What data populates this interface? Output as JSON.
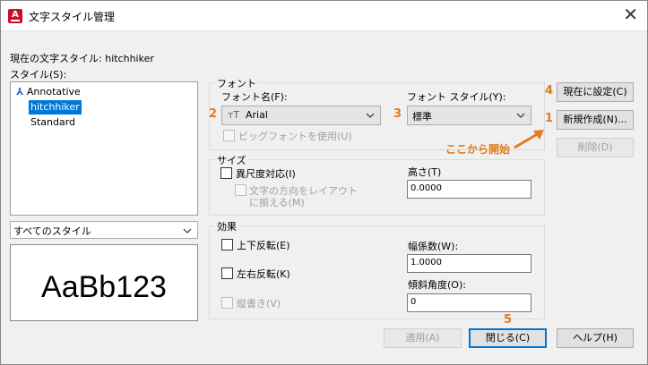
{
  "window": {
    "title": "文字スタイル管理",
    "app_icon_letter": "A"
  },
  "current_style": {
    "label": "現在の文字スタイル:",
    "value": "hitchhiker"
  },
  "styles": {
    "label": "スタイル(S):",
    "items": [
      {
        "name": "Annotative",
        "annotative": true,
        "selected": false
      },
      {
        "name": "hitchhiker",
        "annotative": false,
        "selected": true
      },
      {
        "name": "Standard",
        "annotative": false,
        "selected": false
      }
    ],
    "filter_value": "すべてのスタイル"
  },
  "preview": {
    "text": "AaBb123"
  },
  "font": {
    "group_title": "フォント",
    "font_name_label": "フォント名(F):",
    "font_name_value": "Arial",
    "font_style_label": "フォント スタイル(Y):",
    "font_style_value": "標準",
    "bigfont_label": "ビッグフォントを使用(U)"
  },
  "size": {
    "group_title": "サイズ",
    "annotative_label": "異尺度対応(I)",
    "match_orientation_label_1": "文字の方向をレイアウト",
    "match_orientation_label_2": "に揃える(M)",
    "height_label": "高さ(T)",
    "height_value": "0.0000"
  },
  "effects": {
    "group_title": "効果",
    "upside_down_label": "上下反転(E)",
    "backwards_label": "左右反転(K)",
    "vertical_label": "縦書き(V)",
    "width_factor_label": "幅係数(W):",
    "width_factor_value": "1.0000",
    "oblique_label": "傾斜角度(O):",
    "oblique_value": "0"
  },
  "buttons": {
    "set_current": "現在に設定(C)",
    "new": "新規作成(N)...",
    "delete": "削除(D)",
    "apply": "適用(A)",
    "close": "閉じる(C)",
    "help": "ヘルプ(H)"
  },
  "annotations": {
    "n1": "1",
    "n2": "2",
    "n3": "3",
    "n4": "4",
    "n5": "5",
    "start_here": "ここから開始",
    "color": "#e07b1f"
  }
}
